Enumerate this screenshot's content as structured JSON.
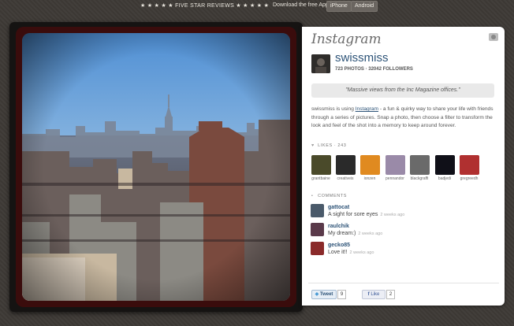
{
  "topbar": {
    "reviews_text": "★ ★ ★ ★ ★   FIVE STAR REVIEWS   ★ ★ ★ ★ ★",
    "download_text": "Download the free App",
    "iphone_label": "iPhone",
    "android_label": "Android"
  },
  "panel": {
    "logo_text": "Instagram",
    "username": "swissmiss",
    "stats": "723 PHOTOS · 32042 FOLLOWERS",
    "caption": "\"Massive views from the Inc Magazine offices.\"",
    "description_prefix": "swissmiss is using ",
    "description_link": "Instagram",
    "description_suffix": " - a fun & quirky way to share your life with friends through a series of pictures. Snap a photo, then choose a filter to transform the look and feel of the shot into a memory to keep around forever.",
    "likes_header": "LIKES · 243",
    "likes": [
      {
        "name": "grantbaine",
        "color": "#4a4a2a"
      },
      {
        "name": "creativeis",
        "color": "#2a2a2a"
      },
      {
        "name": "ionzen",
        "color": "#e08a20"
      },
      {
        "name": "pennandor",
        "color": "#9a8aa8"
      },
      {
        "name": "blackgraffi",
        "color": "#6a6a6a"
      },
      {
        "name": "badjedi",
        "color": "#101018"
      },
      {
        "name": "gregreedh",
        "color": "#b03030"
      }
    ],
    "comments_header": "COMMENTS",
    "comments": [
      {
        "user": "gattocat",
        "text": "A sight for sore eyes",
        "time": "2 weeks ago",
        "color": "#4a5a6a"
      },
      {
        "user": "raulchik",
        "text": "My dream:)",
        "time": "2 weeks ago",
        "color": "#5a3a4a"
      },
      {
        "user": "gecko85",
        "text": "Love it!!",
        "time": "2 weeks ago",
        "color": "#8a2a2a"
      }
    ],
    "tweet_label": "Tweet",
    "tweet_count": "9",
    "like_label": "Like",
    "like_count": "2"
  },
  "colors": {
    "background": "#3e3a36",
    "link": "#2e5478",
    "frame_inner": "#3a0c0c"
  }
}
